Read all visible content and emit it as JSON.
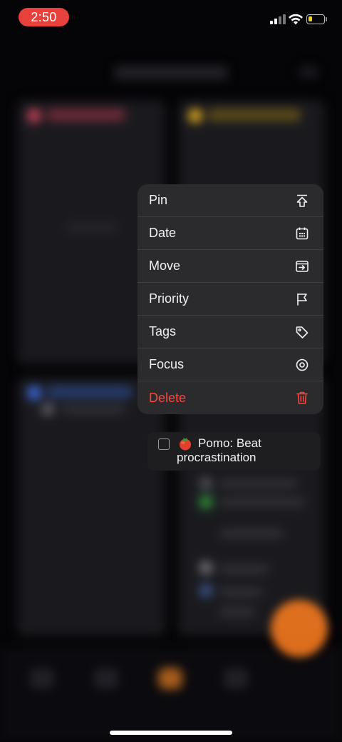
{
  "status_bar": {
    "time": "2:50",
    "cellular_icon": "cellular-signal-icon",
    "wifi_icon": "wifi-icon",
    "battery_icon": "battery-low-icon",
    "battery_color": "#f5d417",
    "time_pill_color": "#e8403a"
  },
  "context_menu": {
    "items": [
      {
        "label": "Pin",
        "icon": "pin-icon"
      },
      {
        "label": "Date",
        "icon": "calendar-icon"
      },
      {
        "label": "Move",
        "icon": "move-icon"
      },
      {
        "label": "Priority",
        "icon": "flag-icon"
      },
      {
        "label": "Tags",
        "icon": "tag-icon"
      },
      {
        "label": "Focus",
        "icon": "focus-icon"
      },
      {
        "label": "Delete",
        "icon": "trash-icon",
        "destructive": true,
        "color": "#ff453a"
      }
    ]
  },
  "task_preview": {
    "emoji": "tomato-icon",
    "title": "Pomo: Beat procrastination",
    "completed": false
  },
  "background": {
    "quadrant_colors": [
      "#c0405a",
      "#d9a520",
      "#3a68d8",
      "#6a6a70"
    ],
    "fab_color": "#e8741e"
  }
}
